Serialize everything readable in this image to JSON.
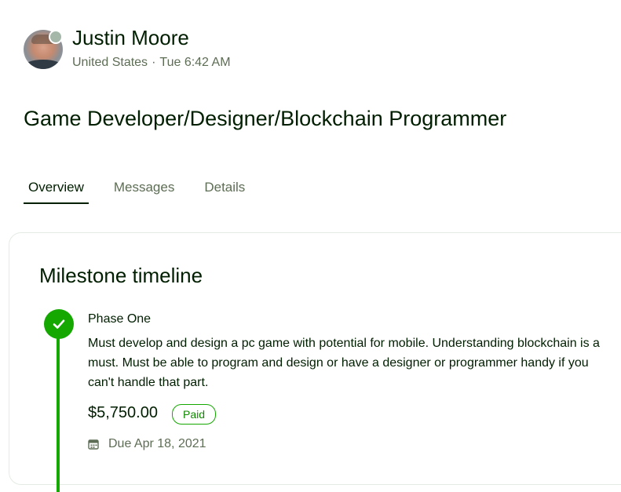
{
  "profile": {
    "name": "Justin Moore",
    "location": "United States",
    "separator": "·",
    "local_time": "Tue 6:42 AM"
  },
  "job": {
    "title": "Game Developer/Designer/Blockchain Programmer"
  },
  "tabs": [
    {
      "label": "Overview",
      "active": true
    },
    {
      "label": "Messages",
      "active": false
    },
    {
      "label": "Details",
      "active": false
    }
  ],
  "milestones": {
    "heading": "Milestone timeline",
    "items": [
      {
        "name": "Phase One",
        "description": "Must develop and design a pc game with potential for mobile. Understanding blockchain is a must. Must be able to program and design or have a designer or programmer handy if you can't handle that part.",
        "amount": "$5,750.00",
        "status": "Paid",
        "due": "Due Apr 18, 2021",
        "completed": true
      }
    ]
  },
  "colors": {
    "brand_green": "#14a800",
    "text_dark": "#001e00",
    "text_muted": "#5e6d55"
  },
  "icons": {
    "avatar": "user-photo",
    "status": "status-dot-icon",
    "milestone": "checkmark-icon",
    "due": "calendar-icon"
  }
}
